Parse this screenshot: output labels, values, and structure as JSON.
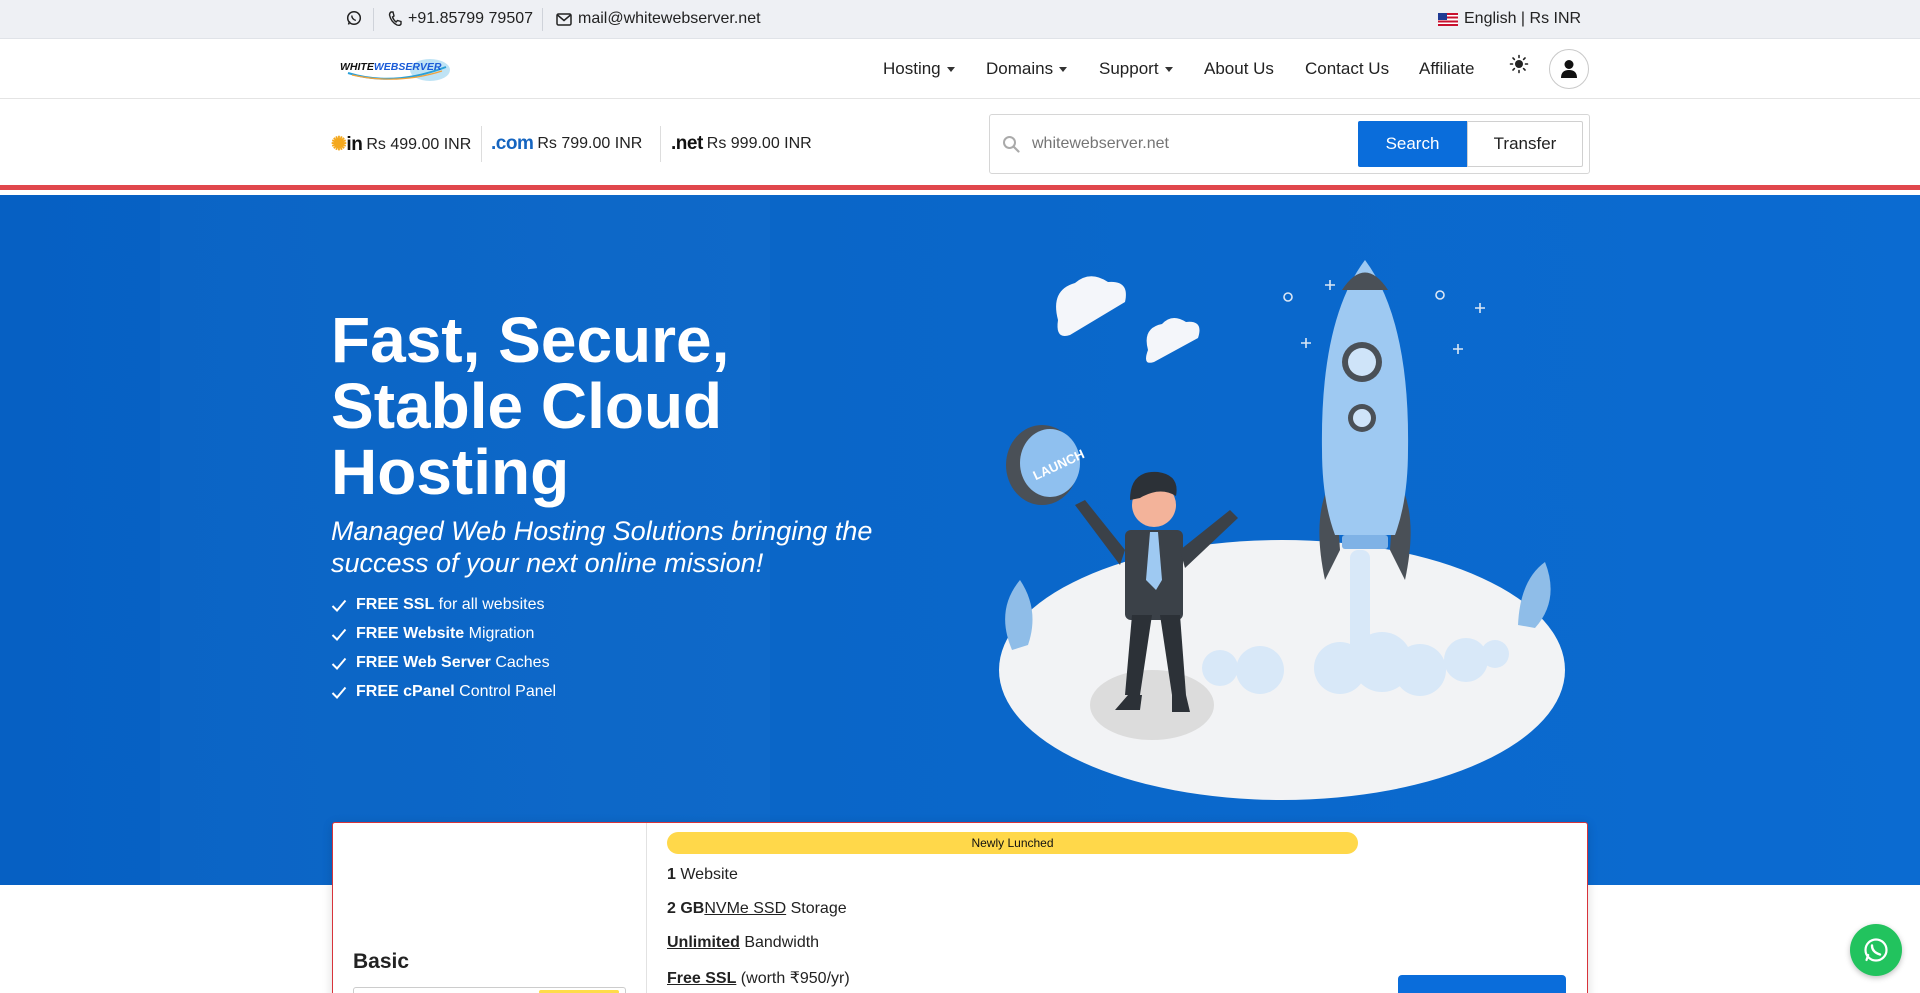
{
  "topbar": {
    "phone": "+91.85799 79507",
    "email": "mail@whitewebserver.net",
    "locale": "English | Rs INR"
  },
  "nav": {
    "logo_text": "WHITEWEBSERVER",
    "items": [
      {
        "label": "Hosting",
        "dropdown": true
      },
      {
        "label": "Domains",
        "dropdown": true
      },
      {
        "label": "Support",
        "dropdown": true
      },
      {
        "label": "About Us",
        "dropdown": false
      },
      {
        "label": "Contact Us",
        "dropdown": false
      },
      {
        "label": "Affiliate",
        "dropdown": false
      }
    ]
  },
  "domains": {
    "tlds": [
      {
        "logo": "in",
        "price": "Rs 499.00 INR"
      },
      {
        "logo": ".com",
        "price": "Rs 799.00 INR"
      },
      {
        "logo": ".net",
        "price": "Rs 999.00 INR"
      }
    ],
    "search_placeholder": "whitewebserver.net",
    "search_button": "Search",
    "transfer_button": "Transfer"
  },
  "hero": {
    "title": "Fast, Secure, Stable Cloud Hosting",
    "subtitle": "Managed Web Hosting Solutions bringing the success of your next online mission!",
    "features": [
      {
        "bold": "FREE SSL",
        "rest": " for all websites"
      },
      {
        "bold": "FREE Website",
        "rest": " Migration"
      },
      {
        "bold": "FREE Web Server",
        "rest": " Caches"
      },
      {
        "bold": "FREE cPanel",
        "rest": " Control Panel"
      }
    ],
    "illustration_text": "LAUNCH"
  },
  "plan": {
    "name": "Basic",
    "badge": "Newly Lunched",
    "specs": [
      {
        "bold": "1",
        "underline": "",
        "rest": " Website"
      },
      {
        "bold": "2 GB",
        "underline": "NVMe SSD",
        "rest": " Storage"
      },
      {
        "bold": "",
        "underline": "Unlimited",
        "rest": " Bandwidth"
      },
      {
        "bold": "",
        "underline": "Free SSL",
        "rest": " (worth ₹950/yr)"
      }
    ]
  },
  "colors": {
    "brand_blue": "#0a6ddb",
    "accent_red": "#e0474c",
    "badge_yellow": "#ffd84a",
    "whatsapp_green": "#22c35e"
  }
}
